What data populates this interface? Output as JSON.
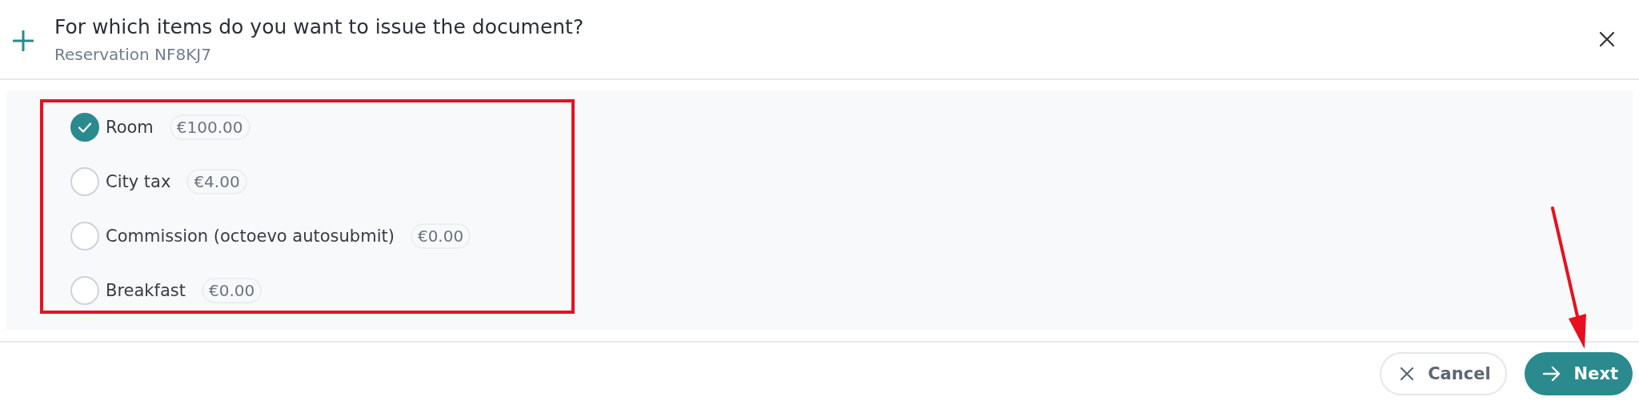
{
  "dialog": {
    "title": "For which items do you want to issue the document?",
    "subtitle": "Reservation NF8KJ7"
  },
  "items": [
    {
      "label": "Room",
      "amount": "€100.00",
      "checked": true
    },
    {
      "label": "City tax",
      "amount": "€4.00",
      "checked": false
    },
    {
      "label": "Commission (octoevo autosubmit)",
      "amount": "€0.00",
      "checked": false
    },
    {
      "label": "Breakfast",
      "amount": "€0.00",
      "checked": false
    }
  ],
  "buttons": [
    {
      "label": "Cancel",
      "kind": "cancel"
    },
    {
      "label": "Next",
      "kind": "next"
    }
  ]
}
